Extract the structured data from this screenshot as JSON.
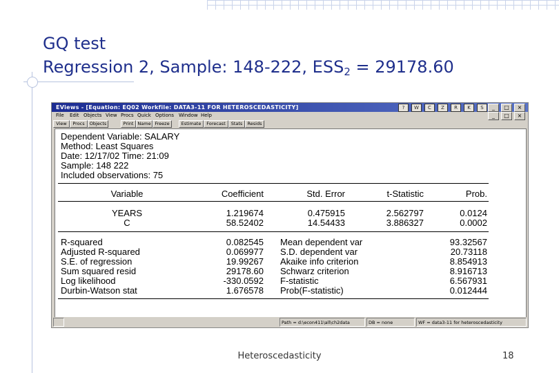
{
  "slide": {
    "title_line1": "GQ test",
    "title_line2_prefix": "Regression 2, Sample: 148-222, ESS",
    "title_line2_sub": "2",
    "title_line2_suffix": " = 29178.60",
    "footer": "Heteroscedasticity",
    "page_number": "18"
  },
  "window": {
    "title": "EViews - [Equation: EQ02   Workfile: DATA3-11 FOR HETEROSCEDASTICITY]",
    "toolbar_icons": [
      "?",
      "W",
      "C",
      "Z",
      "R",
      "K",
      "S"
    ],
    "controls": [
      "_",
      "□",
      "×"
    ],
    "menu": [
      "File",
      "Edit",
      "Objects",
      "View",
      "Procs",
      "Quick",
      "Options",
      "Window",
      "Help"
    ],
    "toolbar": [
      "View",
      "Procs",
      "Objects",
      "Print",
      "Name",
      "Freeze",
      "Estimate",
      "Forecast",
      "Stats",
      "Resids"
    ]
  },
  "output": {
    "header": [
      "Dependent Variable: SALARY",
      "Method: Least Squares",
      "Date: 12/17/02   Time: 21:09",
      "Sample: 148 222",
      "Included observations: 75"
    ],
    "columns": [
      "Variable",
      "Coefficient",
      "Std. Error",
      "t-Statistic",
      "Prob."
    ],
    "rows": [
      {
        "var": "YEARS",
        "coef": "1.219674",
        "se": "0.475915",
        "t": "2.562797",
        "p": "0.0124"
      },
      {
        "var": "C",
        "coef": "58.52402",
        "se": "14.54433",
        "t": "3.886327",
        "p": "0.0002"
      }
    ],
    "stats": [
      {
        "l": "R-squared",
        "lv": "0.082545",
        "r": "Mean dependent var",
        "rv": "93.32567"
      },
      {
        "l": "Adjusted R-squared",
        "lv": "0.069977",
        "r": "S.D. dependent var",
        "rv": "20.73118"
      },
      {
        "l": "S.E. of regression",
        "lv": "19.99267",
        "r": "Akaike info criterion",
        "rv": "8.854913"
      },
      {
        "l": "Sum squared resid",
        "lv": "29178.60",
        "r": "Schwarz criterion",
        "rv": "8.916713"
      },
      {
        "l": "Log likelihood",
        "lv": "-330.0592",
        "r": "F-statistic",
        "rv": "6.567931"
      },
      {
        "l": "Durbin-Watson stat",
        "lv": "1.676578",
        "r": "Prob(F-statistic)",
        "rv": "0.012444"
      }
    ]
  },
  "status": {
    "path": "Path = d:\\econ411\\all\\ch2data",
    "db": "DB = none",
    "wf": "WF = data3-11 for heteroscedasticity"
  },
  "colors": {
    "title": "#1f2f8c",
    "titlebar": "#1c2c92"
  }
}
